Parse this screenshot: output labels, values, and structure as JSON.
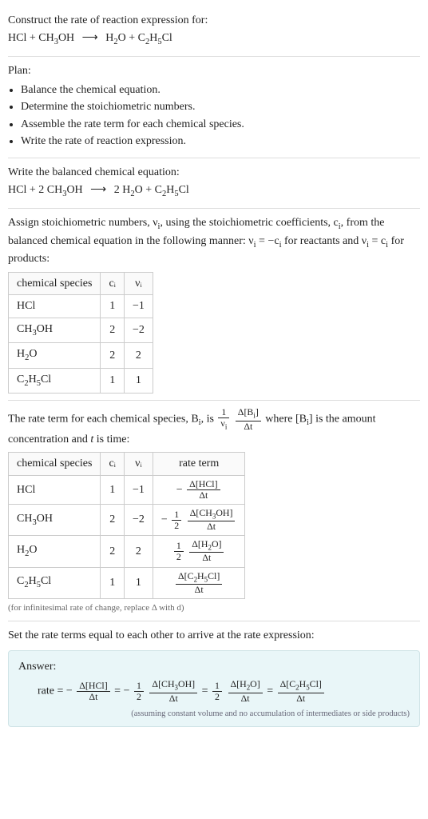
{
  "prompt": {
    "title": "Construct the rate of reaction expression for:",
    "equation_html": "HCl + CH<span class='sub'>3</span>OH <span class='arrow'>⟶</span> H<span class='sub'>2</span>O + C<span class='sub'>2</span>H<span class='sub'>5</span>Cl"
  },
  "plan": {
    "heading": "Plan:",
    "items": [
      "Balance the chemical equation.",
      "Determine the stoichiometric numbers.",
      "Assemble the rate term for each chemical species.",
      "Write the rate of reaction expression."
    ]
  },
  "balanced": {
    "heading": "Write the balanced chemical equation:",
    "equation_html": "HCl + 2 CH<span class='sub'>3</span>OH <span class='arrow'>⟶</span> 2 H<span class='sub'>2</span>O + C<span class='sub'>2</span>H<span class='sub'>5</span>Cl"
  },
  "stoich": {
    "heading_html": "Assign stoichiometric numbers, ν<span class='sub'>i</span>, using the stoichiometric coefficients, c<span class='sub'>i</span>, from the balanced chemical equation in the following manner: ν<span class='sub'>i</span> = −c<span class='sub'>i</span> for reactants and ν<span class='sub'>i</span> = c<span class='sub'>i</span> for products:",
    "headers": [
      "chemical species",
      "cᵢ",
      "νᵢ"
    ],
    "rows": [
      {
        "species_html": "HCl",
        "c": "1",
        "nu": "−1"
      },
      {
        "species_html": "CH<span class='sub'>3</span>OH",
        "c": "2",
        "nu": "−2"
      },
      {
        "species_html": "H<span class='sub'>2</span>O",
        "c": "2",
        "nu": "2"
      },
      {
        "species_html": "C<span class='sub'>2</span>H<span class='sub'>5</span>Cl",
        "c": "1",
        "nu": "1"
      }
    ]
  },
  "rateterms": {
    "heading_html": "The rate term for each chemical species, B<span class='sub'>i</span>, is <span class='frac inline'><span class='num'>1</span><span class='den'>ν<span class='sub'>i</span></span></span> <span class='frac inline'><span class='num'>Δ[B<span class='sub'>i</span>]</span><span class='den'>Δt</span></span> where [B<span class='sub'>i</span>] is the amount concentration and <i>t</i> is time:",
    "headers": [
      "chemical species",
      "cᵢ",
      "νᵢ",
      "rate term"
    ],
    "rows": [
      {
        "species_html": "HCl",
        "c": "1",
        "nu": "−1",
        "term_html": "− <span class='frac'><span class='num'>Δ[HCl]</span><span class='den'>Δt</span></span>"
      },
      {
        "species_html": "CH<span class='sub'>3</span>OH",
        "c": "2",
        "nu": "−2",
        "term_html": "− <span class='frac'><span class='num'>1</span><span class='den'>2</span></span> <span class='frac'><span class='num'>Δ[CH<span class='sub'>3</span>OH]</span><span class='den'>Δt</span></span>"
      },
      {
        "species_html": "H<span class='sub'>2</span>O",
        "c": "2",
        "nu": "2",
        "term_html": "<span class='frac'><span class='num'>1</span><span class='den'>2</span></span> <span class='frac'><span class='num'>Δ[H<span class='sub'>2</span>O]</span><span class='den'>Δt</span></span>"
      },
      {
        "species_html": "C<span class='sub'>2</span>H<span class='sub'>5</span>Cl",
        "c": "1",
        "nu": "1",
        "term_html": "<span class='frac'><span class='num'>Δ[C<span class='sub'>2</span>H<span class='sub'>5</span>Cl]</span><span class='den'>Δt</span></span>"
      }
    ],
    "note": "(for infinitesimal rate of change, replace Δ with d)"
  },
  "final": {
    "heading": "Set the rate terms equal to each other to arrive at the rate expression:"
  },
  "answer": {
    "label": "Answer:",
    "expr_html": "rate = − <span class='frac'><span class='num'>Δ[HCl]</span><span class='den'>Δt</span></span> = − <span class='frac'><span class='num'>1</span><span class='den'>2</span></span> <span class='frac'><span class='num'>Δ[CH<span class='sub'>3</span>OH]</span><span class='den'>Δt</span></span> = <span class='frac'><span class='num'>1</span><span class='den'>2</span></span> <span class='frac'><span class='num'>Δ[H<span class='sub'>2</span>O]</span><span class='den'>Δt</span></span> = <span class='frac'><span class='num'>Δ[C<span class='sub'>2</span>H<span class='sub'>5</span>Cl]</span><span class='den'>Δt</span></span>",
    "note": "(assuming constant volume and no accumulation of intermediates or side products)"
  }
}
